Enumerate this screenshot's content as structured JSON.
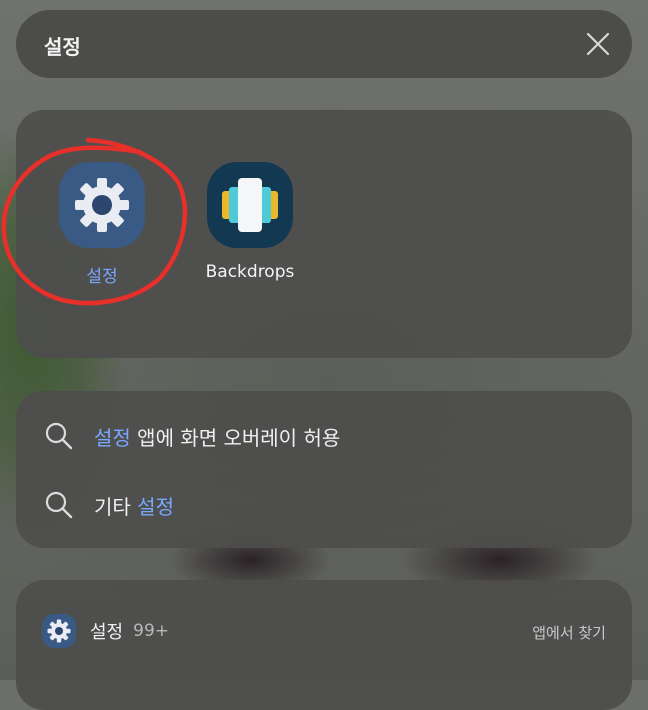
{
  "search": {
    "query": "설정"
  },
  "apps": [
    {
      "label": "설정",
      "icon": "gear-icon",
      "label_color": "#78a8ff"
    },
    {
      "label": "Backdrops",
      "icon": "backdrops-icon",
      "label_color": "#f4f4f4"
    }
  ],
  "suggestions": [
    {
      "highlight": "설정",
      "rest": " 앱에 화면 오버레이 허용"
    },
    {
      "prefix": "기타 ",
      "highlight": "설정"
    }
  ],
  "results": {
    "app_name": "설정",
    "count": "99+",
    "link": "앱에서 찾기"
  },
  "colors": {
    "accent": "#78a8ff",
    "annotation": "#e8302a"
  }
}
